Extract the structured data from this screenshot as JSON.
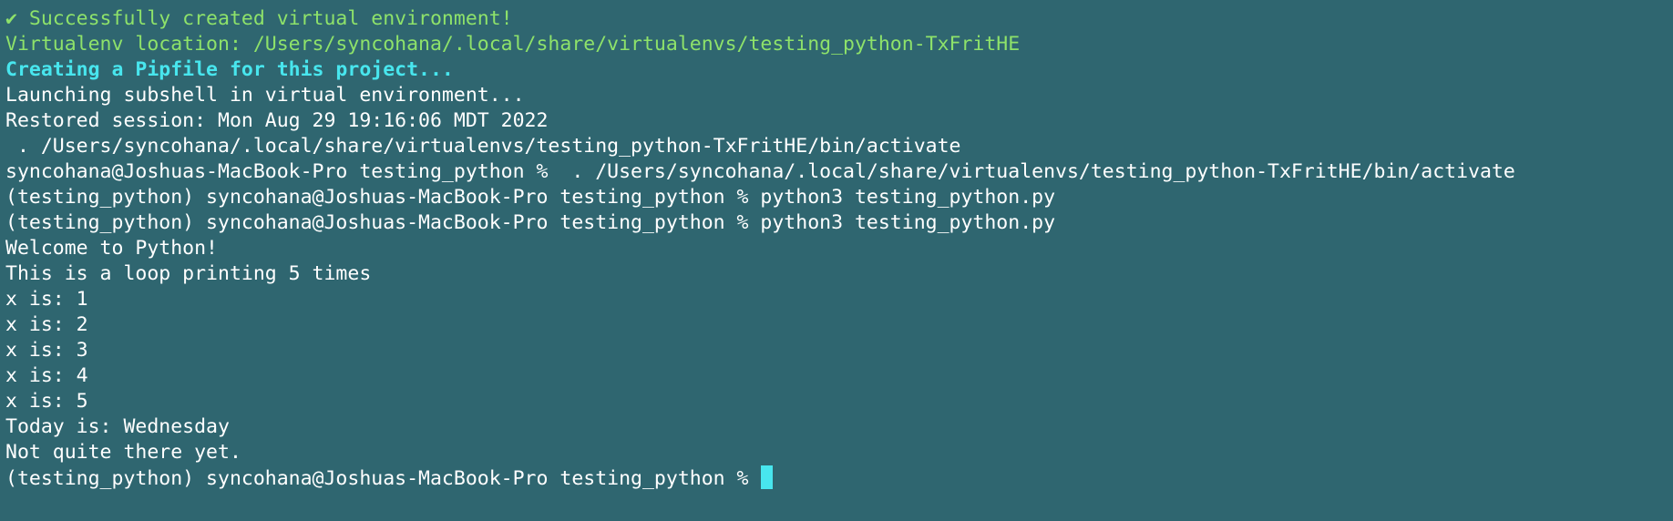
{
  "theme": {
    "background": "#2f6670",
    "text": "#ffffff",
    "success_green": "#8ee26a",
    "info_cyan": "#48e6ee",
    "cursor": "#48e6ee"
  },
  "terminal": {
    "lines": [
      {
        "text": "✔ Successfully created virtual environment!",
        "style": "green"
      },
      {
        "text": "Virtualenv location: /Users/syncohana/.local/share/virtualenvs/testing_python-TxFritHE",
        "style": "green"
      },
      {
        "text": "Creating a Pipfile for this project...",
        "style": "cyan"
      },
      {
        "text": "Launching subshell in virtual environment...",
        "style": "white"
      },
      {
        "text": "Restored session: Mon Aug 29 19:16:06 MDT 2022",
        "style": "white"
      },
      {
        "text": " . /Users/syncohana/.local/share/virtualenvs/testing_python-TxFritHE/bin/activate",
        "style": "white"
      },
      {
        "text": "syncohana@Joshuas-MacBook-Pro testing_python %  . /Users/syncohana/.local/share/virtualenvs/testing_python-TxFritHE/bin/activate",
        "style": "white"
      },
      {
        "text": "(testing_python) syncohana@Joshuas-MacBook-Pro testing_python % python3 testing_python.py",
        "style": "white"
      },
      {
        "text": "(testing_python) syncohana@Joshuas-MacBook-Pro testing_python % python3 testing_python.py",
        "style": "white"
      },
      {
        "text": "Welcome to Python!",
        "style": "white"
      },
      {
        "text": "This is a loop printing 5 times",
        "style": "white"
      },
      {
        "text": "x is: 1",
        "style": "white"
      },
      {
        "text": "x is: 2",
        "style": "white"
      },
      {
        "text": "x is: 3",
        "style": "white"
      },
      {
        "text": "x is: 4",
        "style": "white"
      },
      {
        "text": "x is: 5",
        "style": "white"
      },
      {
        "text": "Today is: Wednesday",
        "style": "white"
      },
      {
        "text": "Not quite there yet.",
        "style": "white"
      }
    ],
    "prompt": "(testing_python) syncohana@Joshuas-MacBook-Pro testing_python % "
  }
}
